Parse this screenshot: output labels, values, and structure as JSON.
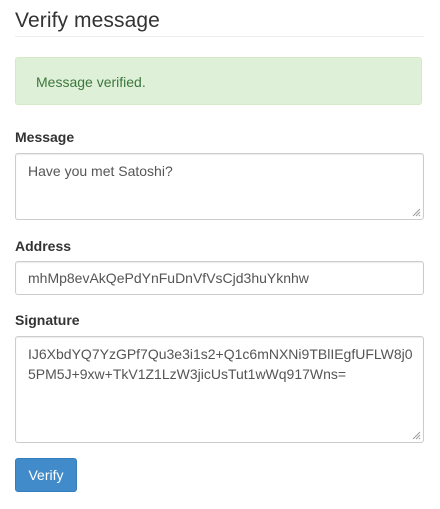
{
  "page": {
    "title": "Verify message"
  },
  "alert": {
    "text": "Message verified.",
    "status": "success"
  },
  "form": {
    "message_label": "Message",
    "message_value": "Have you met Satoshi?",
    "address_label": "Address",
    "address_value": "mhMp8evAkQePdYnFuDnVfVsCjd3huYknhw",
    "signature_label": "Signature",
    "signature_value": "IJ6XbdYQ7YzGPf7Qu3e3i1s2+Q1c6mNXNi9TBlIEgfUFLW8j05PM5J+9xw+TkV1Z1LzW3jicUsTut1wWq917Wns=",
    "verify_label": "Verify"
  },
  "colors": {
    "accent": "#428bca",
    "success_bg": "#dff0d8",
    "success_text": "#3c763d"
  }
}
